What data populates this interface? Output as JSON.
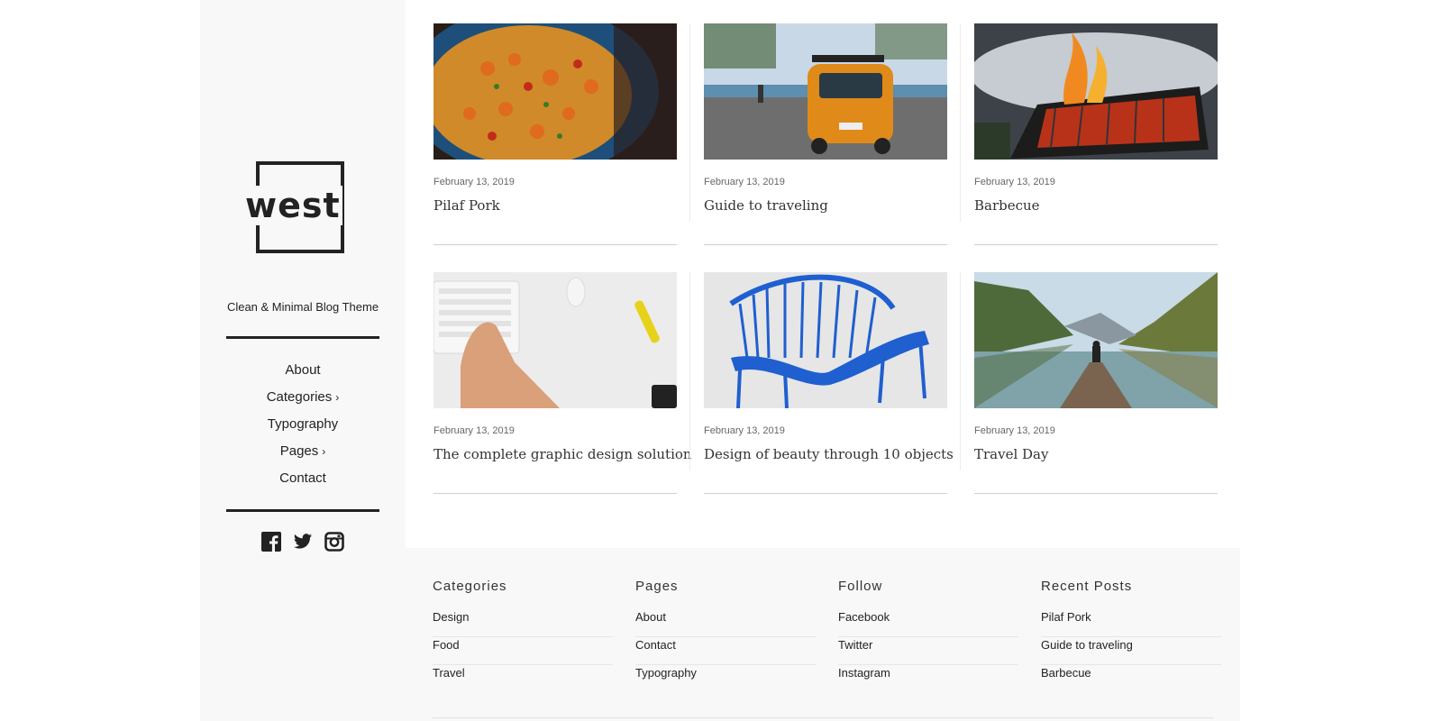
{
  "sidebar": {
    "logo_text": "west",
    "tagline": "Clean & Minimal Blog Theme",
    "nav": [
      {
        "label": "About"
      },
      {
        "label": "Categories",
        "chevron": "›"
      },
      {
        "label": "Typography"
      },
      {
        "label": "Pages",
        "chevron": "›"
      },
      {
        "label": "Contact"
      }
    ],
    "social_icons": [
      "facebook-icon",
      "twitter-icon",
      "instagram-icon"
    ]
  },
  "posts": [
    {
      "date": "February 13, 2019",
      "title": "Pilaf Pork",
      "image": "paella-dish-photo"
    },
    {
      "date": "February 13, 2019",
      "title": "Guide to traveling",
      "image": "orange-van-beach-photo"
    },
    {
      "date": "February 13, 2019",
      "title": "Barbecue",
      "image": "grill-flames-photo"
    },
    {
      "date": "February 13, 2019",
      "title": "The complete graphic design solution",
      "image": "keyboard-hand-photo"
    },
    {
      "date": "February 13, 2019",
      "title": "Design of beauty through 10 objects",
      "image": "blue-chair-photo"
    },
    {
      "date": "February 13, 2019",
      "title": "Travel Day",
      "image": "mountain-lake-pier-photo"
    }
  ],
  "footer": {
    "columns": [
      {
        "heading": "Categories",
        "items": [
          "Design",
          "Food",
          "Travel"
        ]
      },
      {
        "heading": "Pages",
        "items": [
          "About",
          "Contact",
          "Typography"
        ]
      },
      {
        "heading": "Follow",
        "items": [
          "Facebook",
          "Twitter",
          "Instagram"
        ]
      },
      {
        "heading": "Recent Posts",
        "items": [
          "Pilaf Pork",
          "Guide to traveling",
          "Barbecue"
        ]
      }
    ]
  },
  "colors": {
    "accent": "#222222",
    "sidebar_bg": "#f8f8f8",
    "text_muted": "#666666"
  }
}
